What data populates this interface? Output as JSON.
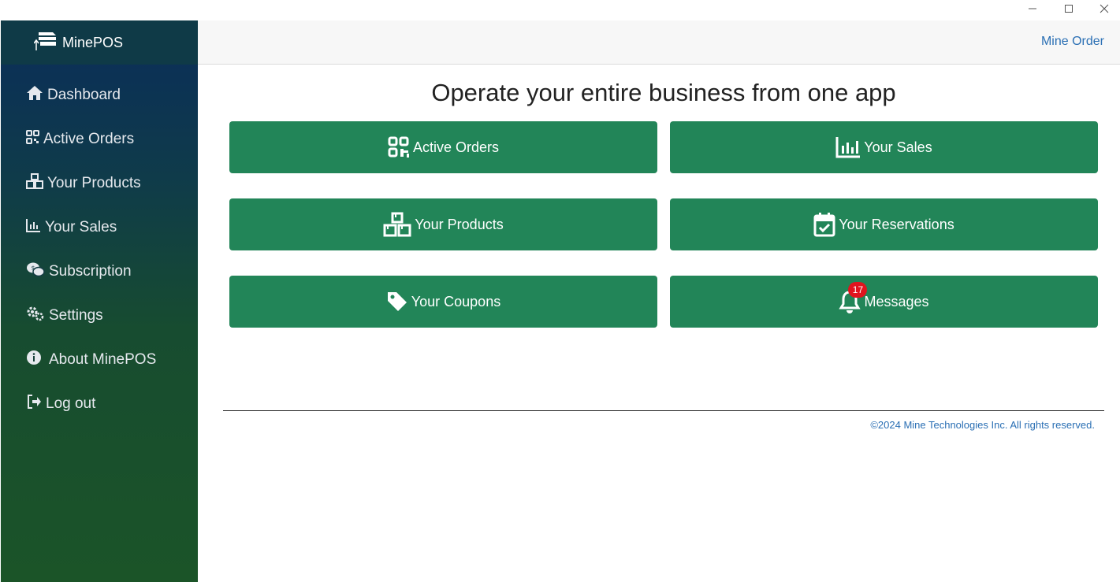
{
  "brand": {
    "name": "MinePOS"
  },
  "header": {
    "link": "Mine Order"
  },
  "sidebar": {
    "items": [
      {
        "label": "Dashboard"
      },
      {
        "label": "Active Orders"
      },
      {
        "label": "Your Products"
      },
      {
        "label": "Your Sales"
      },
      {
        "label": "Subscription"
      },
      {
        "label": "Settings"
      },
      {
        "label": "About MinePOS"
      },
      {
        "label": "Log out"
      }
    ]
  },
  "main": {
    "title": "Operate your entire business from one app",
    "tiles": [
      {
        "label": "Active Orders",
        "icon": "qr-code-icon"
      },
      {
        "label": "Your Sales",
        "icon": "chart-icon"
      },
      {
        "label": "Your Products",
        "icon": "boxes-icon"
      },
      {
        "label": "Your Reservations",
        "icon": "calendar-check-icon"
      },
      {
        "label": "Your Coupons",
        "icon": "tag-icon"
      },
      {
        "label": "Messages",
        "icon": "bell-icon",
        "badge": "17"
      }
    ]
  },
  "footer": {
    "text": "©2024 Mine Technologies Inc. All rights reserved."
  },
  "colors": {
    "tile": "#228558",
    "link": "#2a6fb4",
    "badge": "#e0141e"
  }
}
